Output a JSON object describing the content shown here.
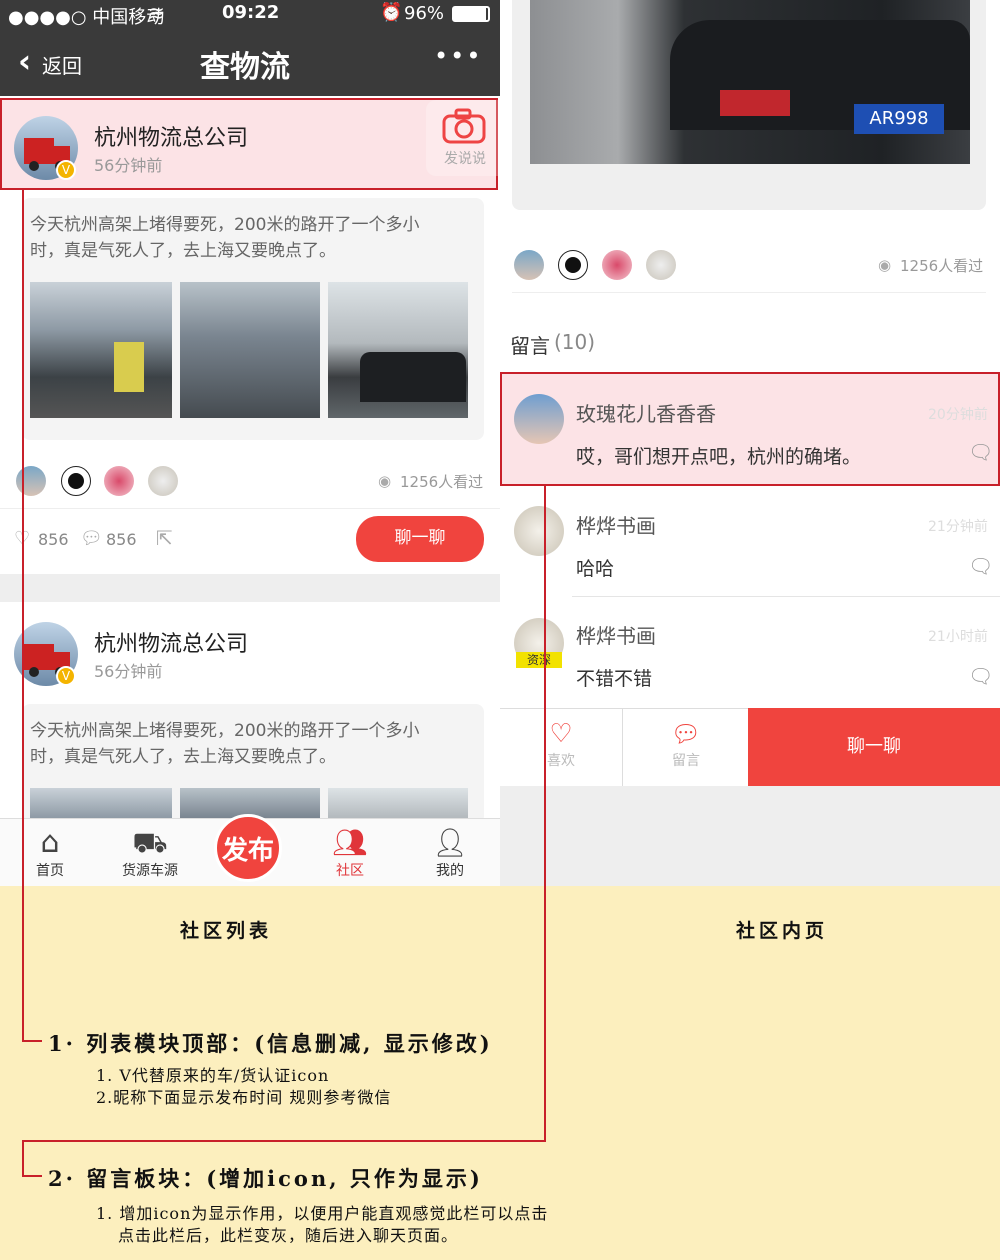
{
  "status_bar": {
    "carrier": "●●●●○ 中国移动",
    "time": "09:22",
    "battery": "96%"
  },
  "nav": {
    "back_label": "返回",
    "title": "查物流",
    "more": "•••"
  },
  "post1": {
    "company": "杭州物流总公司",
    "time": "56分钟前",
    "camera_label": "发说说",
    "text_line1": "今天杭州高架上堵得要死，200米的路开了一个多小",
    "text_line2": "时，真是气死人了，去上海又要晚点了。",
    "views": "1256人看过",
    "likes": "856",
    "comments": "856",
    "chat_button": "聊一聊"
  },
  "post2": {
    "company": "杭州物流总公司",
    "time": "56分钟前",
    "text_line1": "今天杭州高架上堵得要死，200米的路开了一个多小",
    "text_line2": "时，真是气死人了，去上海又要晚点了。"
  },
  "tabbar": [
    {
      "label": "首页"
    },
    {
      "label": "货源车源"
    },
    {
      "label": "发布"
    },
    {
      "label": "社区"
    },
    {
      "label": "我的"
    }
  ],
  "detail": {
    "views": "1256人看过",
    "comments_header": "留言",
    "comments_count": "(10)",
    "comments": [
      {
        "name": "玫瑰花儿香香香",
        "time": "20分钟前",
        "text": "哎，哥们想开点吧，杭州的确堵。"
      },
      {
        "name": "桦烨书画",
        "time": "21分钟前",
        "text": "哈哈"
      },
      {
        "name": "桦烨书画",
        "time": "21小时前",
        "text": "不错不错",
        "badge": "资深"
      }
    ],
    "bottom": {
      "like": "喜欢",
      "comment": "留言",
      "chat": "聊一聊"
    },
    "plate": "AR998"
  },
  "annotations": {
    "left_title": "社区列表",
    "right_title": "社区内页",
    "note1_title": "1· 列表模块顶部：(信息删减, 显示修改)",
    "note1_line1": "1. V代替原来的车/货认证icon",
    "note1_line2": "2.昵称下面显示发布时间     规则参考微信",
    "note2_title": "2· 留言板块：(增加icon, 只作为显示)",
    "note2_line1": "1. 增加icon为显示作用，以便用户能直观感觉此栏可以点击",
    "note2_line2": "点击此栏后，此栏变灰，随后进入聊天页面。"
  },
  "colors": {
    "accent": "#f0443e",
    "highlight_border": "#c8202a",
    "annotation_bg": "#fcefbe",
    "nav_bg": "#3a3a3a"
  }
}
